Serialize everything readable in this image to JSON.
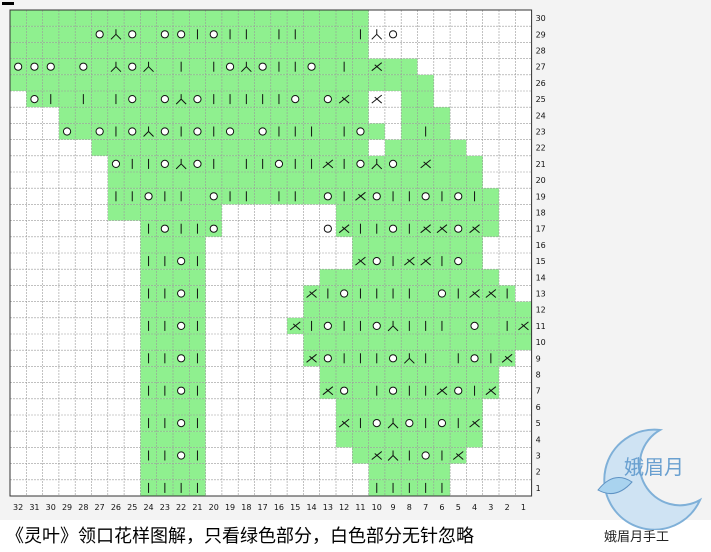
{
  "chart": {
    "columns": 32,
    "rows": 30,
    "column_labels_order": "right-to-left",
    "green_color": "#8ff08f",
    "white_color": "#ffffff",
    "grid_line_color": "#9a9a9a",
    "green_rows": {
      "30": [
        [
          11,
          32
        ]
      ],
      "29": [
        [
          11,
          32
        ]
      ],
      "28": [
        [
          11,
          32
        ]
      ],
      "27": [
        [
          8,
          32
        ]
      ],
      "26": [
        [
          7,
          32
        ]
      ],
      "25": [
        [
          7,
          8
        ],
        [
          11,
          31
        ]
      ],
      "24": [
        [
          6,
          8
        ],
        [
          11,
          29
        ]
      ],
      "23": [
        [
          6,
          8
        ],
        [
          10,
          29
        ]
      ],
      "22": [
        [
          5,
          9
        ],
        [
          11,
          27
        ]
      ],
      "21": [
        [
          4,
          26
        ]
      ],
      "20": [
        [
          4,
          26
        ]
      ],
      "19": [
        [
          3,
          26
        ]
      ],
      "18": [
        [
          3,
          12
        ],
        [
          20,
          26
        ]
      ],
      "17": [
        [
          3,
          12
        ],
        [
          20,
          24
        ]
      ],
      "16": [
        [
          4,
          11
        ],
        [
          21,
          24
        ]
      ],
      "15": [
        [
          4,
          11
        ],
        [
          21,
          24
        ]
      ],
      "14": [
        [
          3,
          13
        ],
        [
          21,
          24
        ]
      ],
      "13": [
        [
          2,
          14
        ],
        [
          21,
          24
        ]
      ],
      "12": [
        [
          1,
          14
        ],
        [
          21,
          24
        ]
      ],
      "11": [
        [
          1,
          15
        ],
        [
          21,
          24
        ]
      ],
      "10": [
        [
          1,
          14
        ],
        [
          21,
          24
        ]
      ],
      "9": [
        [
          2,
          14
        ],
        [
          21,
          24
        ]
      ],
      "8": [
        [
          3,
          13
        ],
        [
          21,
          24
        ]
      ],
      "7": [
        [
          3,
          13
        ],
        [
          21,
          24
        ]
      ],
      "6": [
        [
          4,
          12
        ],
        [
          21,
          24
        ]
      ],
      "5": [
        [
          4,
          12
        ],
        [
          21,
          24
        ]
      ],
      "4": [
        [
          4,
          12
        ],
        [
          21,
          24
        ]
      ],
      "3": [
        [
          5,
          11
        ],
        [
          21,
          24
        ]
      ],
      "2": [
        [
          6,
          10
        ],
        [
          21,
          24
        ]
      ],
      "1": [
        [
          6,
          10
        ],
        [
          21,
          24
        ]
      ]
    },
    "symbols": {
      "29": {
        "9": "O",
        "10": "Y",
        "11": "I",
        "15": "I",
        "16": "I",
        "18": "I",
        "19": "I",
        "20": "O",
        "21": "I",
        "22": "O",
        "23": "O",
        "25": "O",
        "26": "Y",
        "27": "O"
      },
      "27": {
        "10": "X",
        "12": "I",
        "14": "O",
        "15": "I",
        "16": "I",
        "17": "O",
        "18": "Y",
        "19": "O",
        "20": "I",
        "22": "I",
        "24": "Y",
        "25": "O",
        "26": "Y",
        "28": "O",
        "30": "O",
        "31": "O",
        "32": "O"
      },
      "25": {
        "10": "X",
        "12": "X",
        "13": "O",
        "15": "O",
        "16": "I",
        "17": "I",
        "18": "I",
        "19": "I",
        "20": "I",
        "21": "O",
        "22": "Y",
        "23": "O",
        "25": "O",
        "26": "I",
        "28": "I",
        "30": "I",
        "31": "O"
      },
      "23": {
        "7": "I",
        "11": "O",
        "12": "I",
        "14": "I",
        "15": "I",
        "16": "I",
        "17": "O",
        "19": "O",
        "20": "I",
        "21": "O",
        "22": "I",
        "23": "O",
        "24": "Y",
        "25": "O",
        "26": "I",
        "27": "O",
        "29": "O"
      },
      "21": {
        "7": "X",
        "9": "O",
        "10": "Y",
        "11": "O",
        "12": "I",
        "13": "X",
        "14": "I",
        "15": "I",
        "16": "O",
        "17": "I",
        "18": "I",
        "20": "I",
        "21": "O",
        "22": "Y",
        "23": "O",
        "24": "I",
        "25": "I",
        "26": "O"
      },
      "19": {
        "4": "I",
        "5": "O",
        "6": "I",
        "7": "O",
        "8": "I",
        "9": "I",
        "10": "O",
        "11": "X",
        "12": "I",
        "13": "O",
        "15": "I",
        "16": "I",
        "18": "I",
        "19": "I",
        "20": "O",
        "22": "I",
        "23": "I",
        "24": "O",
        "25": "I",
        "26": "I"
      },
      "17": {
        "4": "X",
        "5": "O",
        "6": "X",
        "7": "X",
        "8": "I",
        "9": "O",
        "10": "I",
        "11": "I",
        "12": "X",
        "13": "O",
        "20": "O",
        "21": "I",
        "22": "I",
        "23": "O",
        "24": "I"
      },
      "15": {
        "5": "O",
        "6": "I",
        "7": "X",
        "8": "X",
        "9": "I",
        "10": "O",
        "11": "X",
        "21": "I",
        "22": "O",
        "23": "I",
        "24": "I"
      },
      "13": {
        "2": "I",
        "3": "X",
        "4": "X",
        "5": "I",
        "6": "O",
        "8": "I",
        "9": "I",
        "10": "I",
        "11": "I",
        "12": "O",
        "13": "I",
        "14": "X",
        "21": "I",
        "22": "O",
        "23": "I",
        "24": "I"
      },
      "11": {
        "1": "X",
        "2": "I",
        "4": "O",
        "6": "I",
        "7": "I",
        "8": "I",
        "9": "Y",
        "10": "O",
        "11": "I",
        "12": "I",
        "13": "O",
        "14": "I",
        "15": "X",
        "21": "I",
        "22": "O",
        "23": "I",
        "24": "I"
      },
      "9": {
        "2": "X",
        "3": "I",
        "4": "O",
        "5": "I",
        "7": "I",
        "8": "Y",
        "9": "O",
        "10": "I",
        "11": "I",
        "12": "I",
        "13": "O",
        "14": "X",
        "21": "I",
        "22": "O",
        "23": "I",
        "24": "I"
      },
      "7": {
        "3": "X",
        "4": "I",
        "5": "O",
        "6": "X",
        "7": "I",
        "8": "I",
        "9": "O",
        "10": "I",
        "12": "O",
        "13": "X",
        "21": "I",
        "22": "O",
        "23": "I",
        "24": "I"
      },
      "5": {
        "4": "X",
        "5": "I",
        "6": "O",
        "7": "I",
        "8": "O",
        "9": "Y",
        "10": "O",
        "11": "I",
        "12": "X",
        "21": "I",
        "22": "O",
        "23": "I",
        "24": "I"
      },
      "3": {
        "5": "X",
        "6": "I",
        "7": "O",
        "8": "I",
        "9": "Y",
        "10": "X",
        "21": "I",
        "22": "O",
        "23": "I",
        "24": "I"
      },
      "1": {
        "6": "I",
        "7": "I",
        "8": "I",
        "9": "I",
        "10": "I",
        "21": "I",
        "22": "I",
        "23": "I",
        "24": "I"
      }
    }
  },
  "caption": "《灵叶》领口花样图解，只看绿色部分，白色部分无针忽略",
  "watermark": {
    "logo_text": "娥眉月",
    "account_text": "娥眉月手工",
    "logo_color": "#7fb0d8"
  }
}
